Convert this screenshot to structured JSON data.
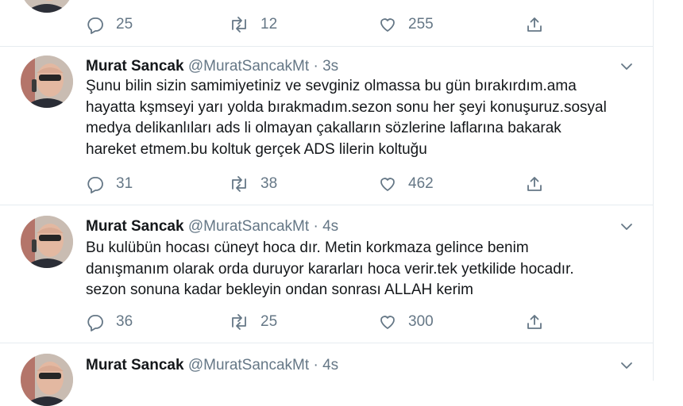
{
  "colors": {
    "text": "#14171a",
    "muted": "#657786",
    "border": "#e6ecf0",
    "link": "#1da1f2"
  },
  "icons": [
    "reply-icon",
    "retweet-icon",
    "like-icon",
    "share-icon",
    "chevron-down-icon"
  ],
  "tweets": [
    {
      "name": "",
      "handle": "",
      "time": "",
      "text": "",
      "replies": "25",
      "retweets": "12",
      "likes": "255"
    },
    {
      "name": "Murat Sancak",
      "handle": "@MuratSancakMt",
      "time": "3s",
      "text": "Şunu bilin sizin samimiyetiniz ve sevginiz olmassa bu gün bırakırdım.ama\nhayatta kşmseyi yarı yolda bırakmadım.sezon sonu her şeyi konuşuruz.sosyal\nmedya delikanlıları ads li olmayan çakalların sözlerine laflarına bakarak\nhareket etmem.bu koltuk gerçek ADS lilerin koltuğu",
      "replies": "31",
      "retweets": "38",
      "likes": "462"
    },
    {
      "name": "Murat Sancak",
      "handle": "@MuratSancakMt",
      "time": "4s",
      "text": "Bu kulübün hocası cüneyt hoca dır. Metin korkmaza gelince benim\ndanışmanım olarak orda duruyor kararları hoca verir.tek yetkilide hocadır.\nsezon sonuna kadar bekleyin ondan sonrası ALLAH kerim",
      "replies": "36",
      "retweets": "25",
      "likes": "300"
    },
    {
      "name": "Murat Sancak",
      "handle": "@MuratSancakMt",
      "time": "4s",
      "text": ""
    }
  ],
  "separator": "·"
}
